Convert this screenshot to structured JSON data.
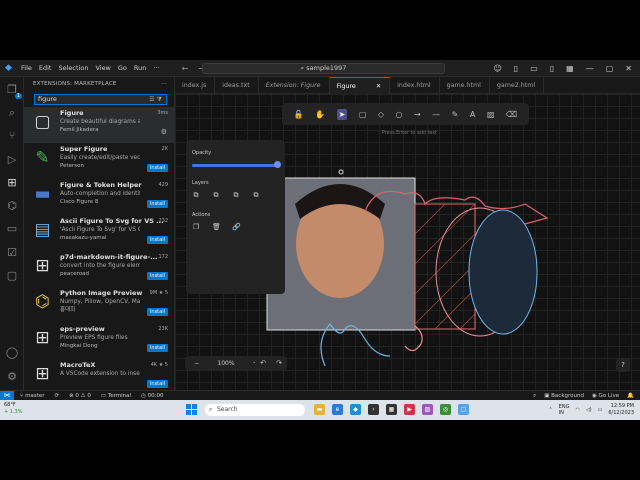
{
  "titlebar": {
    "menu": [
      "File",
      "Edit",
      "Selection",
      "View",
      "Go",
      "Run"
    ],
    "more": "···",
    "command_center": "sample1997"
  },
  "sidebar": {
    "header": "EXTENSIONS: MARKETPLACE",
    "search_value": "figure",
    "extensions": [
      {
        "name": "Figure",
        "desc": "Create beautiful diagrams and sketc...",
        "publisher": "Femil Jikadera",
        "stats": "3ms",
        "action": "gear"
      },
      {
        "name": "Super Figure",
        "desc": "Easily create/edit/paste vector and b...",
        "publisher": "Peterson",
        "stats": "2K",
        "action": "Install"
      },
      {
        "name": "Figure & Token Helper",
        "desc": "Auto-completion and identification ...",
        "publisher": "Cisco Figure 8",
        "stats": "429",
        "action": "Install"
      },
      {
        "name": "Ascii Figure To Svg for VS ...",
        "desc": "'Ascii Figure To Svg' for VS Code Mar...",
        "publisher": "masakazu-yamai",
        "stats": "232",
        "action": "Install"
      },
      {
        "name": "p7d-markdown-it-figure-...",
        "desc": "convert into the figure element with ...",
        "publisher": "peaceroad",
        "stats": "172",
        "action": "Install"
      },
      {
        "name": "Python Image Preview",
        "desc": "Numpy, Pillow, OpenCV, Matplotlib, ...",
        "publisher": "홍대희",
        "stats": "9M ★ 5",
        "action": "Install"
      },
      {
        "name": "eps-preview",
        "desc": "Preview EPS figure files",
        "publisher": "Mingkai Dong",
        "stats": "23K",
        "action": "Install"
      },
      {
        "name": "MacroTeX",
        "desc": "A VSCode extension to insert LaTeX ...",
        "publisher": "",
        "stats": "4K ★ 5",
        "action": "Install"
      }
    ]
  },
  "tabs": [
    "index.js",
    "ideas.txt",
    "Extension: Figure",
    "Figure",
    "index.html",
    "game.html",
    "game2.html"
  ],
  "canvas": {
    "hint": "Press Enter to add text",
    "panel": {
      "opacity_label": "Opacity",
      "opacity": 1.0,
      "layers_label": "Layers",
      "actions_label": "Actions"
    },
    "zoom": "100%"
  },
  "statusbar": {
    "branch": "master",
    "problems": "⊗ 0 ⚠ 0",
    "terminal": "Terminal",
    "time_item": "00:00",
    "background": "Background",
    "liveshare": "Go Live"
  },
  "taskbar": {
    "temp": "68°F",
    "change": "+ 1.3%",
    "search": "Search",
    "lang": "ENG",
    "region": "IN",
    "time": "12:59 PM",
    "date": "6/12/2023"
  }
}
